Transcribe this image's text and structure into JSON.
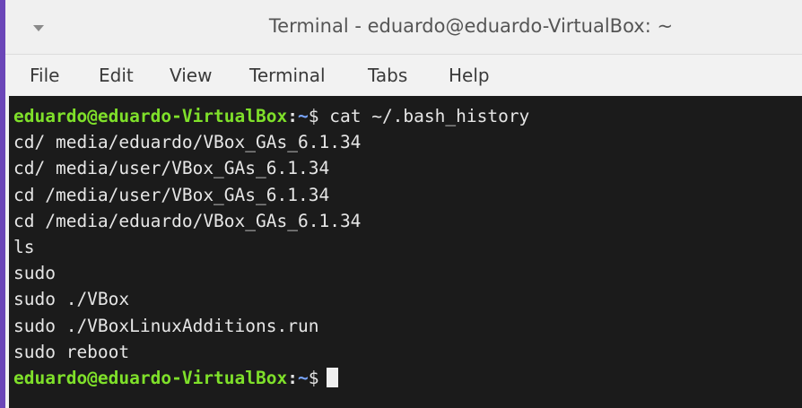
{
  "window": {
    "title": "Terminal - eduardo@eduardo-VirtualBox: ~"
  },
  "menu": {
    "items": [
      "File",
      "Edit",
      "View",
      "Terminal",
      "Tabs",
      "Help"
    ]
  },
  "terminal": {
    "prompt": {
      "user_host": "eduardo@eduardo-VirtualBox",
      "colon": ":",
      "path": "~",
      "sign": "$"
    },
    "command": " cat ~/.bash_history",
    "output": [
      "cd/ media/eduardo/VBox_GAs_6.1.34",
      "cd/ media/user/VBox_GAs_6.1.34",
      "cd /media/user/VBox_GAs_6.1.34",
      "cd /media/eduardo/VBox_GAs_6.1.34",
      "ls",
      "sudo",
      "sudo ./VBox",
      "sudo ./VBoxLinuxAdditions.run",
      "sudo reboot"
    ]
  },
  "colors": {
    "prompt_user": "#7fe02a",
    "prompt_path": "#7aa6ff",
    "terminal_bg": "#1b1b1b",
    "terminal_fg": "#e6e6e6",
    "window_edge": "#6b46b8"
  },
  "icons": {
    "window_menu": "chevron-down-icon",
    "cursor": "block-cursor"
  }
}
